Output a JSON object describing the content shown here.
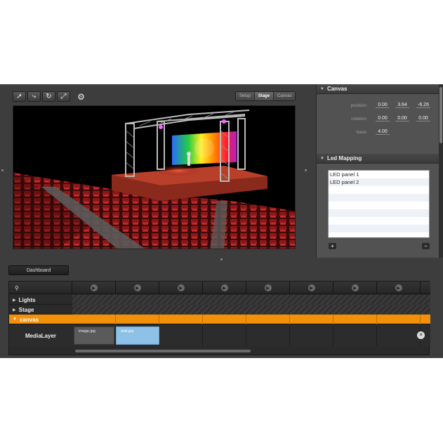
{
  "toolbar": {
    "tools": [
      {
        "icon": "cursor-icon",
        "glyph": "➚"
      },
      {
        "icon": "move-icon",
        "glyph": "⤷"
      },
      {
        "icon": "rotate-icon",
        "glyph": "↻"
      },
      {
        "icon": "scale-icon",
        "glyph": "⤢"
      }
    ],
    "gear_glyph": "⚙"
  },
  "view_tabs": [
    "Setup",
    "Stage",
    "Canvas"
  ],
  "active_view_tab": "Stage",
  "inspector": {
    "canvas": {
      "title": "Canvas",
      "position_label": "position",
      "position": [
        "0.00",
        "3.64",
        "-6.26"
      ],
      "rotation_label": "rotation",
      "rotation": [
        "0.00",
        "0.00",
        "0.00"
      ],
      "base_label": "base",
      "base": "4.00"
    },
    "led_mapping": {
      "title": "Led Mapping",
      "items": [
        "LED panel 1",
        "LED panel 2"
      ],
      "add_glyph": "+",
      "remove_glyph": "−"
    }
  },
  "dashboard_label": "Dashboard",
  "timeline": {
    "search_glyph": "⚲",
    "play_glyph": "▶",
    "tracks": [
      {
        "label": "Lights",
        "expanded": false
      },
      {
        "label": "Stage",
        "expanded": false
      },
      {
        "label": "canvas",
        "expanded": true
      }
    ],
    "media_layer": {
      "label": "MediaLayer",
      "clips": [
        "image.jpg",
        "wall.jpg"
      ],
      "remove_glyph": "✕"
    }
  },
  "colors": {
    "accent_orange": "#f2900a",
    "clip_blue": "#8ec1e6",
    "app_bg": "#3d3d3d"
  }
}
